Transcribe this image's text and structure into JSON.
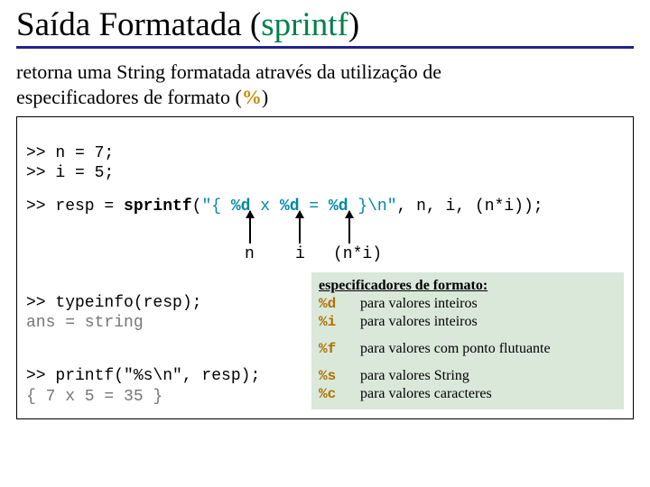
{
  "title": {
    "main": "Saída Formatada (",
    "accent": "sprintf",
    "close": ")"
  },
  "intro": {
    "line1": "retorna uma String formatada através da utilização de",
    "line2a": "especificadores de formato (",
    "pct": "%",
    "line2b": ")"
  },
  "code": {
    "assign_n": ">> n = 7;",
    "assign_i": ">> i = 5;",
    "resp_prefix": ">> resp = ",
    "resp_fn": "sprintf",
    "resp_open": "(",
    "resp_str1": "\"{ ",
    "resp_pd1": "%d",
    "resp_str2": " x ",
    "resp_pd2": "%d",
    "resp_str3": " = ",
    "resp_pd3": "%d",
    "resp_str4": " }\\n\"",
    "resp_args": ", n, i, (n*i));",
    "arrows": {
      "n": "n",
      "i": "i",
      "ni": "(n*i)"
    },
    "typeinfo": ">> typeinfo(resp);",
    "ans": "ans = string",
    "printf": ">> printf(\"%s\\n\", resp);",
    "output": "{ 7 x 5 = 35 }"
  },
  "spec": {
    "heading": "especificadores de formato:",
    "rows": [
      {
        "code": "%d",
        "desc": "para valores inteiros"
      },
      {
        "code": "%i",
        "desc": "para valores inteiros"
      },
      {
        "code": "%f",
        "desc": "para valores com ponto flutuante"
      },
      {
        "code": "%s",
        "desc": "para valores String"
      },
      {
        "code": "%c",
        "desc": "para valores caracteres"
      }
    ]
  }
}
